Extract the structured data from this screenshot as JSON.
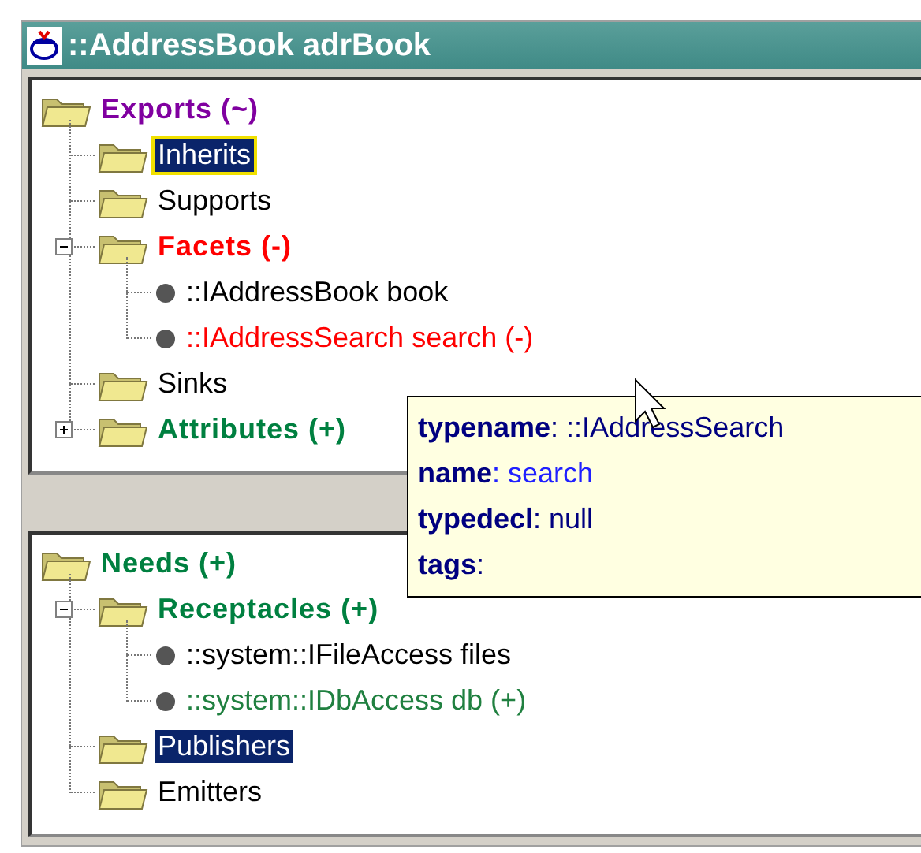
{
  "window": {
    "title": "::AddressBook adrBook"
  },
  "exports": {
    "label": "Exports  (~)",
    "kind": "folder",
    "color": "#8000a0",
    "selected": false,
    "children": [
      {
        "label": "Inherits",
        "kind": "folder",
        "selected": true,
        "focused": true
      },
      {
        "label": "Supports",
        "kind": "folder",
        "selected": false
      },
      {
        "label": "Facets  (-)",
        "kind": "folder",
        "color": "#ff0000",
        "expanded": true,
        "selected": false,
        "children": [
          {
            "label": "::IAddressBook book",
            "kind": "item",
            "selected": false
          },
          {
            "label": "::IAddressSearch search  (-)",
            "kind": "item",
            "color": "#ff0000",
            "selected": false
          }
        ]
      },
      {
        "label": "Sinks",
        "kind": "folder",
        "selected": false
      },
      {
        "label": "Attributes  (+)",
        "kind": "folder",
        "color": "#008040",
        "expanded": false,
        "selected": false
      }
    ]
  },
  "needs": {
    "label": "Needs  (+)",
    "kind": "folder",
    "color": "#008040",
    "selected": false,
    "children": [
      {
        "label": "Receptacles  (+)",
        "kind": "folder",
        "color": "#008040",
        "expanded": true,
        "selected": false,
        "children": [
          {
            "label": "::system::IFileAccess files",
            "kind": "item",
            "selected": false
          },
          {
            "label": "::system::IDbAccess db  (+)",
            "kind": "item",
            "color": "#208040",
            "selected": false
          }
        ]
      },
      {
        "label": "Publishers",
        "kind": "folder",
        "selected": true,
        "focused": false
      },
      {
        "label": "Emitters",
        "kind": "folder",
        "selected": false
      }
    ]
  },
  "tooltip": {
    "fields": [
      {
        "text": "**typename**: ::IAddressSearch",
        "color": "#000080"
      },
      {
        "text": "**name**: search",
        "color": "#2020ff"
      },
      {
        "text": "**typedecl**: null",
        "color": "#000080"
      },
      {
        "text": "**tags**:",
        "color": "#000080"
      }
    ]
  }
}
